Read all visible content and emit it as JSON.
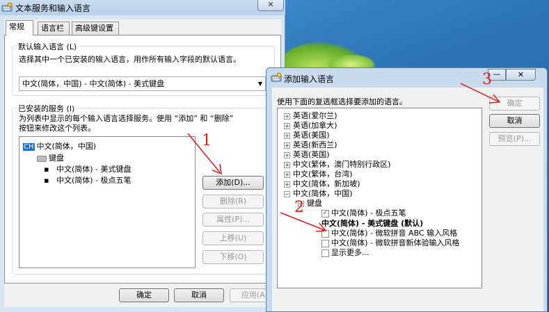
{
  "main_window": {
    "title": "文本服务和输入语言",
    "close_label": "✕",
    "tabs": [
      {
        "label": "常规"
      },
      {
        "label": "语言栏"
      },
      {
        "label": "高级键设置"
      }
    ],
    "default_language": {
      "group_label": "默认输入语言 (L)",
      "description": "选择其中一个已安装的输入语言，用作所有输入字段的默认语言。",
      "selected_value": "中文(简体，中国) - 中文(简体) - 美式键盘"
    },
    "installed_services": {
      "group_label": "已安装的服务 (I)",
      "description_line1": "为列表中显示的每个输入语言选择服务。使用 “添加” 和 “删除”",
      "description_line2": "按钮来修改这个列表。",
      "tree": {
        "language_badge": "CH",
        "language": "中文(简体，中国)",
        "category": "键盘",
        "items": [
          "中文(简体) - 美式键盘",
          "中文(简体) - 极点五笔"
        ]
      },
      "buttons": {
        "add": "添加(D)...",
        "remove": "删除(R)",
        "properties": "属性(P)...",
        "move_up": "上移(U)",
        "move_down": "下移(O)"
      }
    },
    "footer": {
      "ok": "确定",
      "cancel": "取消",
      "apply": "应用(A)"
    }
  },
  "dialog": {
    "title": "添加输入语言",
    "minimize_label": "—",
    "close_label": "✕",
    "instruction": "使用下面的复选框选择要添加的语言。",
    "buttons": {
      "ok": "确定",
      "cancel": "取消",
      "preview": "预览(P)..."
    },
    "tree": {
      "languages": [
        "英语(爱尔兰)",
        "英语(加拿大)",
        "英语(美国)",
        "英语(新西兰)",
        "英语(英国)",
        "中文(繁体，澳门特别行政区)",
        "中文(繁体，台湾)",
        "中文(简体，新加坡)",
        "中文(简体，中国)"
      ],
      "category": "键盘",
      "keyboards": [
        {
          "label": "中文(简体) - 极点五笔",
          "checked": true
        },
        {
          "label": "中文(简体) - 美式键盘 (默认)",
          "is_default": true
        },
        {
          "label": "中文(简体) - 微软拼音 ABC 输入风格",
          "checked": false
        },
        {
          "label": "中文(简体) - 微软拼音新体验输入风格",
          "checked": false
        },
        {
          "label": "显示更多...",
          "checked": false
        }
      ]
    }
  },
  "annotations": {
    "step1": "1",
    "step2": "2",
    "step3": "3",
    "color": "#e21b1b"
  },
  "icons": {
    "window_icon": "keyboard-settings-icon",
    "dialog_icon": "keyboard-settings-icon",
    "tree_expand": "plus-box-icon",
    "tree_collapse": "minus-box-icon",
    "keyboard": "keyboard-icon",
    "checkbox_checked": "checkmark-icon"
  }
}
